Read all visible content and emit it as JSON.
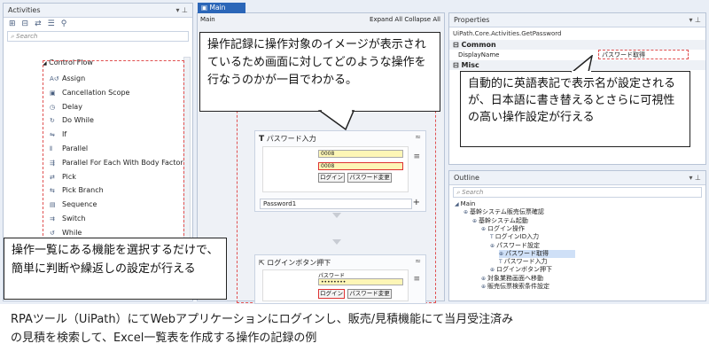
{
  "activities": {
    "title": "Activities",
    "pin": "▾ ⊥",
    "search_placeholder": "Search",
    "tree_root": "Control Flow",
    "items": [
      {
        "label": "Assign",
        "icon": "assign-icon"
      },
      {
        "label": "Cancellation Scope",
        "icon": "cancellation-scope-icon"
      },
      {
        "label": "Delay",
        "icon": "delay-icon"
      },
      {
        "label": "Do While",
        "icon": "do-while-icon"
      },
      {
        "label": "If",
        "icon": "if-icon"
      },
      {
        "label": "Parallel",
        "icon": "parallel-icon"
      },
      {
        "label": "Parallel For Each With Body Factory",
        "icon": "parallel-foreach-icon"
      },
      {
        "label": "Pick",
        "icon": "pick-icon"
      },
      {
        "label": "Pick Branch",
        "icon": "pick-branch-icon"
      },
      {
        "label": "Sequence",
        "icon": "sequence-icon"
      },
      {
        "label": "Switch",
        "icon": "switch-icon"
      },
      {
        "label": "While",
        "icon": "while-icon"
      }
    ]
  },
  "designer": {
    "tab": "Main",
    "main_label": "Main",
    "expand": "Expand All",
    "collapse": "Collapse All",
    "activity1": {
      "title": "パスワード入力",
      "field1": "0008",
      "field2": "0008",
      "login_btn": "ログイン",
      "change_btn": "パスワード変更",
      "input_value": "Password1",
      "plus": "+"
    },
    "activity2": {
      "title": "ログインボタン押下",
      "label": "パスワード",
      "dots": "••••••••",
      "login_btn": "ログイン",
      "change_btn": "パスワード変更"
    }
  },
  "properties": {
    "title": "Properties",
    "subtitle": "UiPath.Core.Activities.GetPassword",
    "section_common": "Common",
    "display_name_label": "DisplayName",
    "display_name_value": "パスワード取得",
    "section_misc": "Misc"
  },
  "outline": {
    "title": "Outline",
    "search_placeholder": "Search",
    "items": [
      {
        "label": "Main"
      },
      {
        "label": "基幹システム販売伝票確認"
      },
      {
        "label": "基幹システム起動"
      },
      {
        "label": "ログイン操作"
      },
      {
        "label": "ログインID入力"
      },
      {
        "label": "パスワード設定"
      },
      {
        "label": "パスワード取得"
      },
      {
        "label": "パスワード入力"
      },
      {
        "label": "ログインボタン押下"
      },
      {
        "label": "対象業務画面へ移動"
      },
      {
        "label": "販売伝票検索条件設定"
      }
    ]
  },
  "callouts": {
    "top": "操作記録に操作対象のイメージが表示されているため画面に対してどのような操作を行なうのかが一目でわかる。",
    "right": "自動的に英語表記で表示名が設定されるが、日本語に書き替えるとさらに可視性の高い操作設定が行える",
    "left": "操作一覧にある機能を選択するだけで、簡単に判断や繰返しの設定が行える"
  },
  "caption": {
    "line1": "RPAツール（UiPath）にてWebアプリケーションにログインし、販売/見積機能にて当月受注済み",
    "line2": "の見積を検索して、Excel一覧表を作成する操作の記録の例"
  }
}
